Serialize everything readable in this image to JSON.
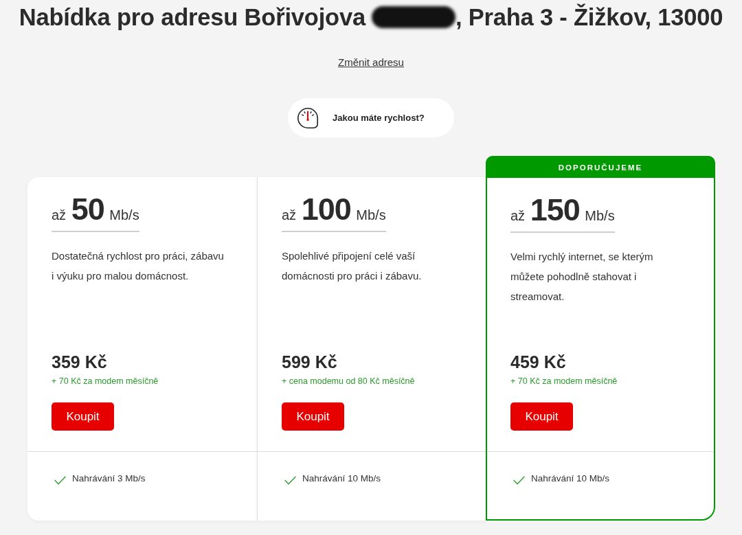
{
  "heading": {
    "title_start": "Nabídka pro adresu Bořivojova",
    "house_number_redacted": true,
    "title_end": ", Praha 3 - Žižkov, 13000"
  },
  "change_address_link": "Změnit adresu",
  "speed_test_button": {
    "label": "Jakou máte rychlost?"
  },
  "plans": [
    {
      "recommended": false,
      "speed": "až **50** Mb/s",
      "description": "Dostatečná rychlost pro práci, zábavu i výuku pro malou domácnost.",
      "price": "359 Kč",
      "modem_note": "+ 70 Kč za modem měsíčně",
      "buy_button": "Koupit",
      "features": [
        "Nahrávání 3 Mb/s"
      ]
    },
    {
      "recommended": false,
      "speed": "až **100** Mb/s",
      "description": "Spolehlivé připojení celé vaší domácnosti pro práci i zábavu.",
      "price": "599 Kč",
      "modem_note": "+ cena modemu od 80 Kč měsíčně",
      "buy_button": "Koupit",
      "features": [
        "Nahrávání 10 Mb/s"
      ]
    },
    {
      "recommended": true,
      "badge": "DOPORUČUJEME",
      "speed": "až **150** Mb/s",
      "description": "Velmi rychlý internet, se kterým můžete pohodlně stahovat i streamovat.",
      "price": "459 Kč",
      "modem_note": "+ 70 Kč za modem měsíčně",
      "buy_button": "Koupit",
      "features": [
        "Nahrávání 10 Mb/s"
      ]
    }
  ]
}
